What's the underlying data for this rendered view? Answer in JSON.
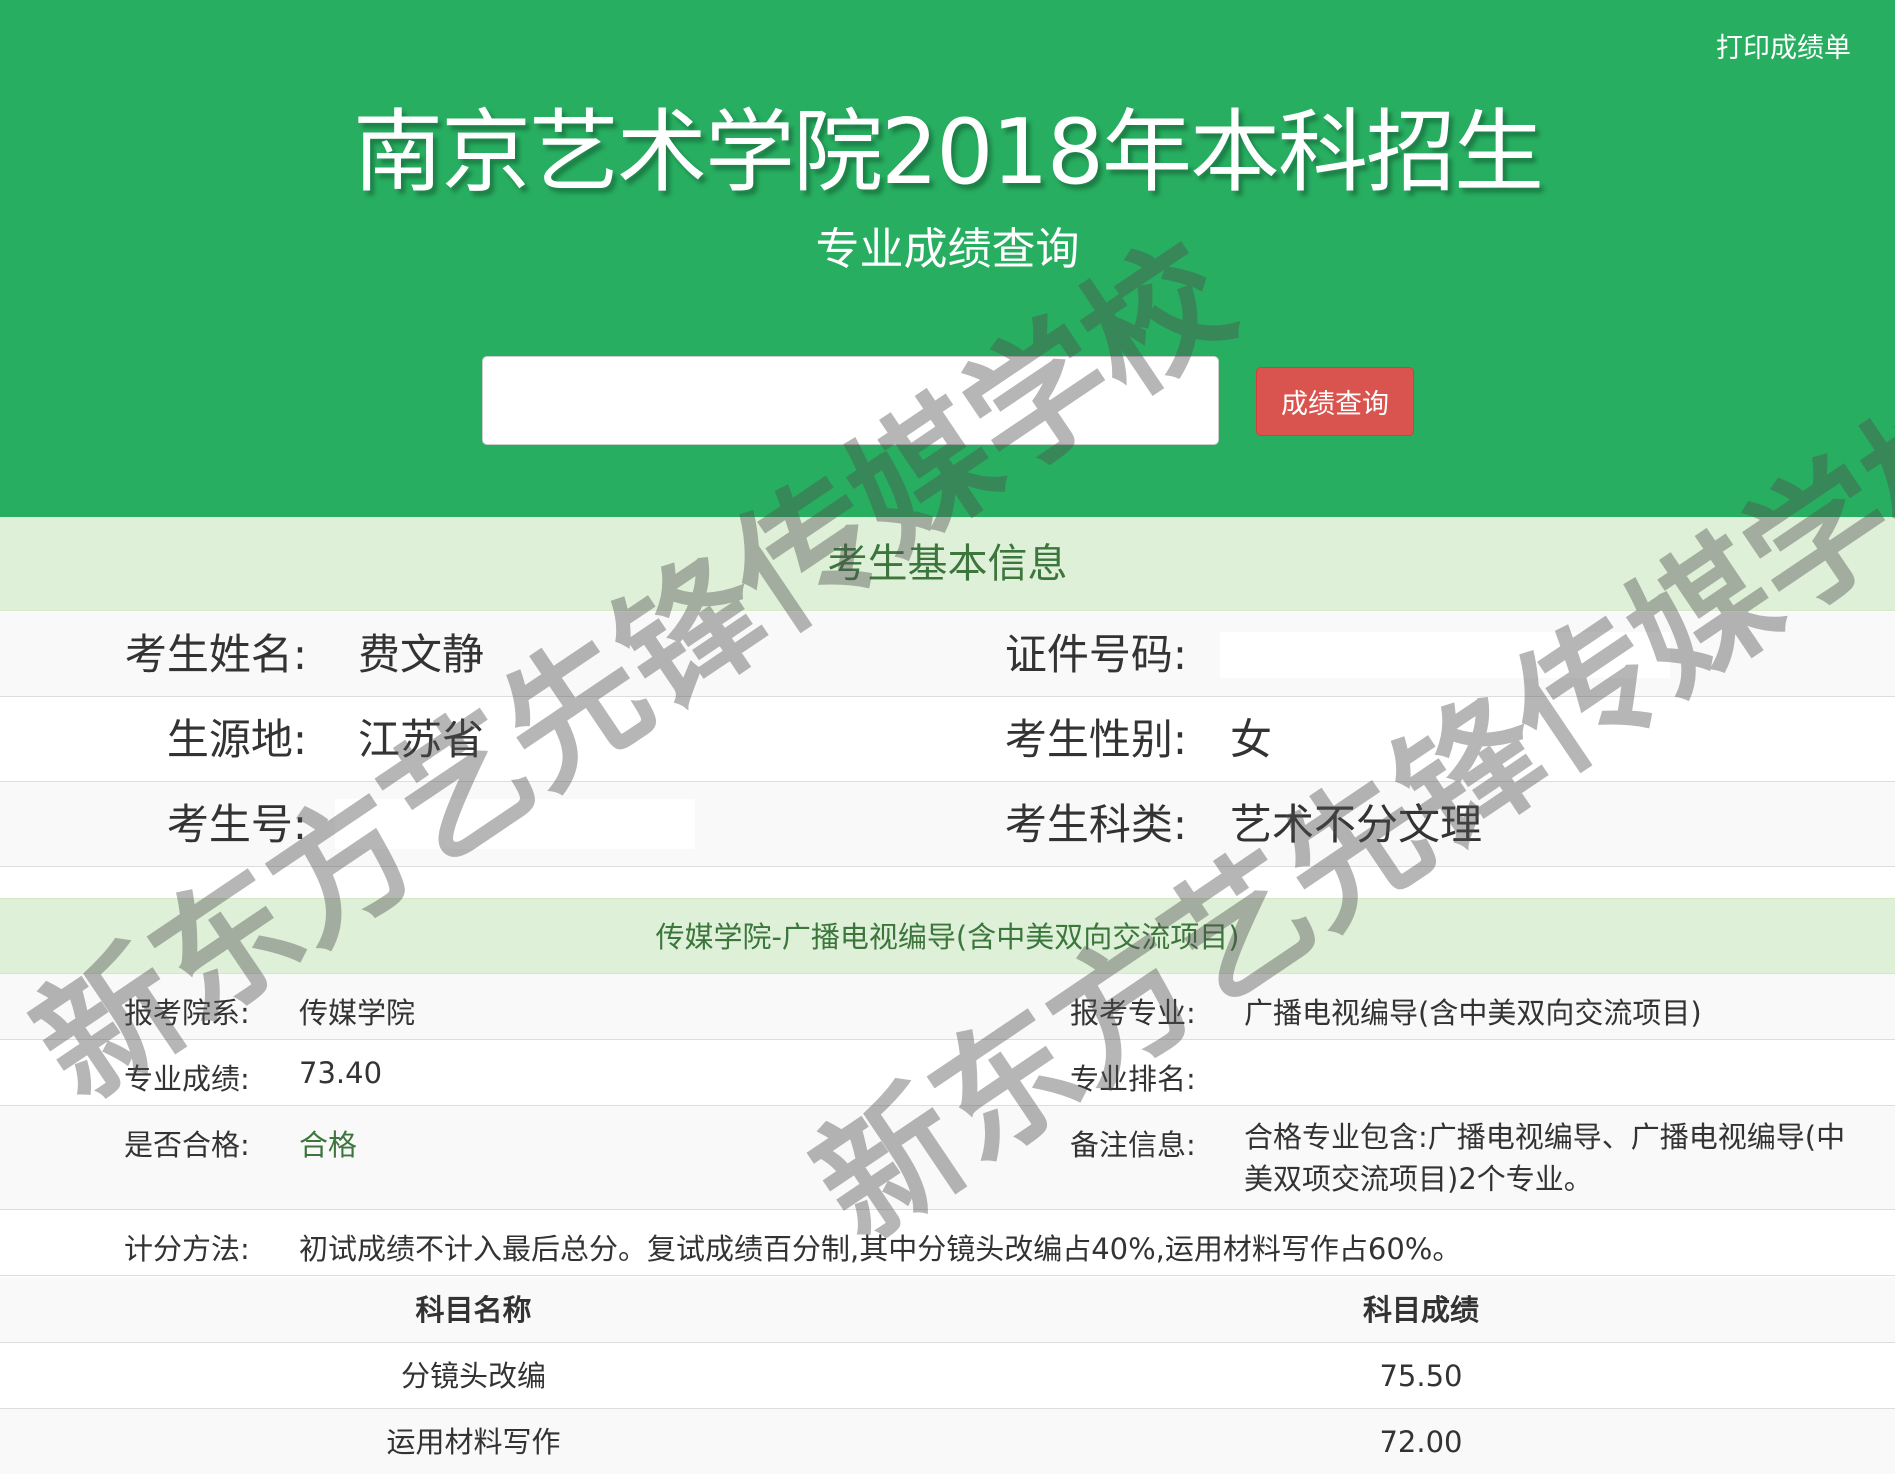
{
  "header": {
    "print_label": "打印成绩单",
    "title": "南京艺术学院2018年本科招生",
    "subtitle": "专业成绩查询",
    "search_placeholder": "",
    "search_button": "成绩查询"
  },
  "basic_info": {
    "heading": "考生基本信息",
    "name_label": "考生姓名:",
    "name_value": "费文静",
    "id_label": "证件号码:",
    "id_value": "",
    "origin_label": "生源地:",
    "origin_value": "江苏省",
    "gender_label": "考生性别:",
    "gender_value": "女",
    "exam_no_label": "考生号:",
    "exam_no_value": "",
    "category_label": "考生科类:",
    "category_value": "艺术不分文理"
  },
  "major": {
    "heading": "传媒学院-广播电视编导(含中美双向交流项目)",
    "dept_label": "报考院系:",
    "dept_value": "传媒学院",
    "major_label": "报考专业:",
    "major_value": "广播电视编导(含中美双向交流项目)",
    "score_label": "专业成绩:",
    "score_value": "73.40",
    "rank_label": "专业排名:",
    "rank_value": "",
    "qualified_label": "是否合格:",
    "qualified_value": "合格",
    "remark_label": "备注信息:",
    "remark_value": "合格专业包含:广播电视编导、广播电视编导(中美双项交流项目)2个专业。",
    "method_label": "计分方法:",
    "method_value": "初试成绩不计入最后总分。复试成绩百分制,其中分镜头改编占40%,运用材料写作占60%。"
  },
  "scores_table": {
    "headers": [
      "科目名称",
      "科目成绩"
    ],
    "rows": [
      [
        "分镜头改编",
        "75.50"
      ],
      [
        "运用材料写作",
        "72.00"
      ]
    ]
  },
  "watermark": {
    "text": "新东方艺先锋传媒学校"
  },
  "colors": {
    "header_bg": "#27ae60",
    "button_bg": "#d9534f",
    "panel_heading_bg": "#dff0d8",
    "panel_heading_text": "#3c763d"
  }
}
